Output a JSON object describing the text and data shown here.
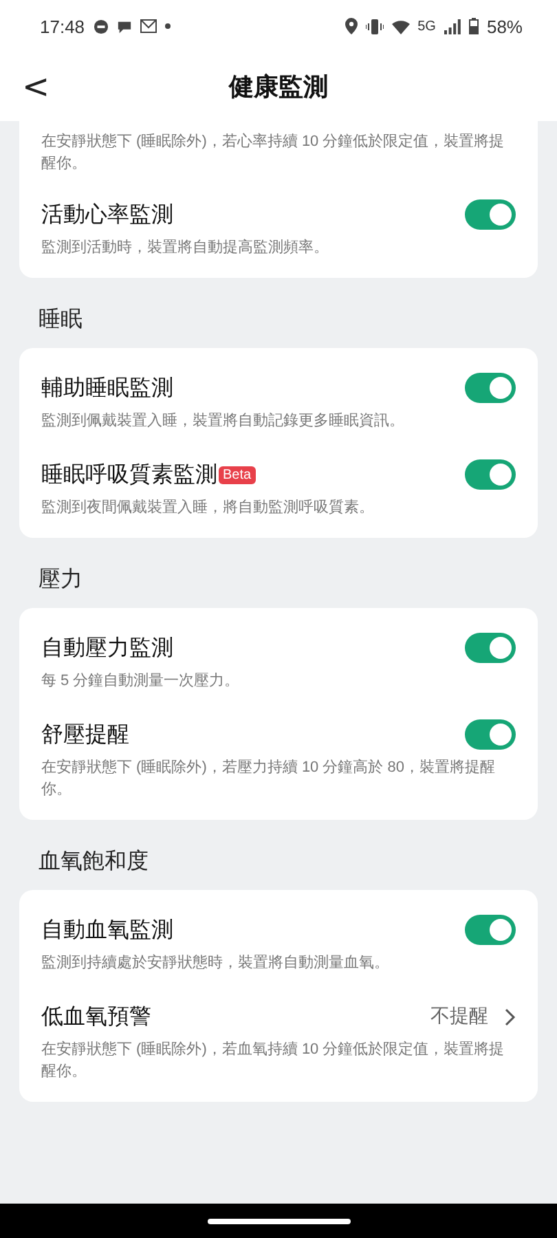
{
  "status_bar": {
    "time": "17:48",
    "network": "5G",
    "battery": "58%"
  },
  "header": {
    "back": "<",
    "title": "健康監測"
  },
  "sections": [
    {
      "cards": [
        {
          "items": [
            {
              "kind": "text",
              "description": "在安靜狀態下 (睡眠除外)，若心率持續 10 分鐘低於限定值，裝置將提醒你。"
            },
            {
              "kind": "toggle",
              "title": "活動心率監測",
              "description": "監測到活動時，裝置將自動提高監測頻率。",
              "on": true
            }
          ]
        }
      ]
    },
    {
      "heading": "睡眠",
      "cards": [
        {
          "items": [
            {
              "kind": "toggle",
              "title": "輔助睡眠監測",
              "description": "監測到佩戴裝置入睡，裝置將自動記錄更多睡眠資訊。",
              "on": true
            },
            {
              "kind": "toggle",
              "title": "睡眠呼吸質素監測",
              "badge": "Beta",
              "description": "監測到夜間佩戴裝置入睡，將自動監測呼吸質素。",
              "on": true
            }
          ]
        }
      ]
    },
    {
      "heading": "壓力",
      "cards": [
        {
          "items": [
            {
              "kind": "toggle",
              "title": "自動壓力監測",
              "description": "每 5 分鐘自動測量一次壓力。",
              "on": true
            },
            {
              "kind": "toggle",
              "title": "舒壓提醒",
              "description": "在安靜狀態下 (睡眠除外)，若壓力持續 10 分鐘高於 80，裝置將提醒你。",
              "on": true
            }
          ]
        }
      ]
    },
    {
      "heading": "血氧飽和度",
      "cards": [
        {
          "items": [
            {
              "kind": "toggle",
              "title": "自動血氧監測",
              "description": "監測到持續處於安靜狀態時，裝置將自動測量血氧。",
              "on": true
            },
            {
              "kind": "link",
              "title": "低血氧預警",
              "value": "不提醒",
              "description": "在安靜狀態下 (睡眠除外)，若血氧持續 10 分鐘低於限定值，裝置將提醒你。"
            }
          ]
        }
      ]
    }
  ]
}
